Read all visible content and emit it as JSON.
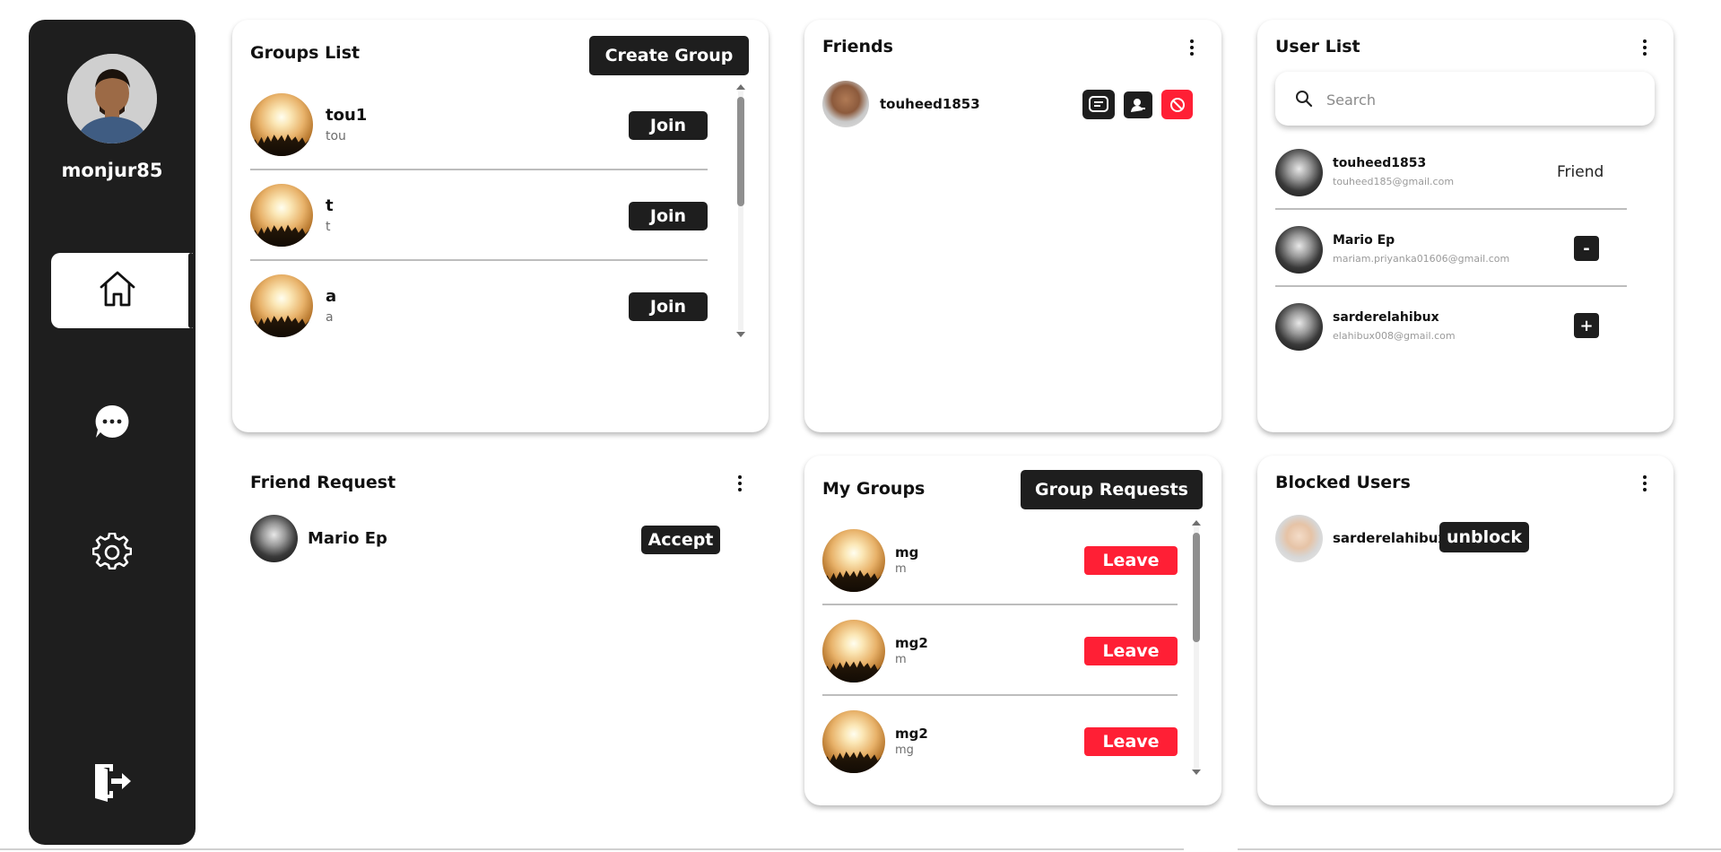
{
  "sidebar": {
    "profile_name": "monjur85",
    "nav": {
      "home_icon": "home-icon",
      "chat_icon": "chat-icon",
      "settings_icon": "settings-icon",
      "logout_icon": "logout-icon"
    }
  },
  "groups_list": {
    "title": "Groups List",
    "create_label": "Create Group",
    "items": [
      {
        "name": "tou1",
        "sub": "tou",
        "action": "Join"
      },
      {
        "name": "t",
        "sub": "t",
        "action": "Join"
      },
      {
        "name": "a",
        "sub": "a",
        "action": "Join"
      }
    ]
  },
  "friends": {
    "title": "Friends",
    "items": [
      {
        "name": "touheed1853",
        "actions": [
          "message-icon",
          "profile-icon",
          "block-icon"
        ]
      }
    ]
  },
  "user_list": {
    "title": "User List",
    "search_placeholder": "Search",
    "items": [
      {
        "name": "touheed1853",
        "email": "touheed185@gmail.com",
        "action": "Friend"
      },
      {
        "name": "Mario Ep",
        "email": "mariam.priyanka01606@gmail.com",
        "action": "-"
      },
      {
        "name": "sarderelahibux",
        "email": "elahibux008@gmail.com",
        "action": "+"
      }
    ]
  },
  "friend_request": {
    "title": "Friend Request",
    "items": [
      {
        "name": "Mario Ep",
        "action": "Accept"
      }
    ]
  },
  "my_groups": {
    "title": "My Groups",
    "requests_label": "Group Requests",
    "items": [
      {
        "name": "mg",
        "sub": "m",
        "action": "Leave"
      },
      {
        "name": "mg2",
        "sub": "m",
        "action": "Leave"
      },
      {
        "name": "mg2",
        "sub": "mg",
        "action": "Leave"
      }
    ]
  },
  "blocked_users": {
    "title": "Blocked Users",
    "items": [
      {
        "name": "sarderelahibux",
        "action": "unblock"
      }
    ]
  },
  "colors": {
    "dark": "#1e1e1e",
    "red": "#ff1f35"
  }
}
